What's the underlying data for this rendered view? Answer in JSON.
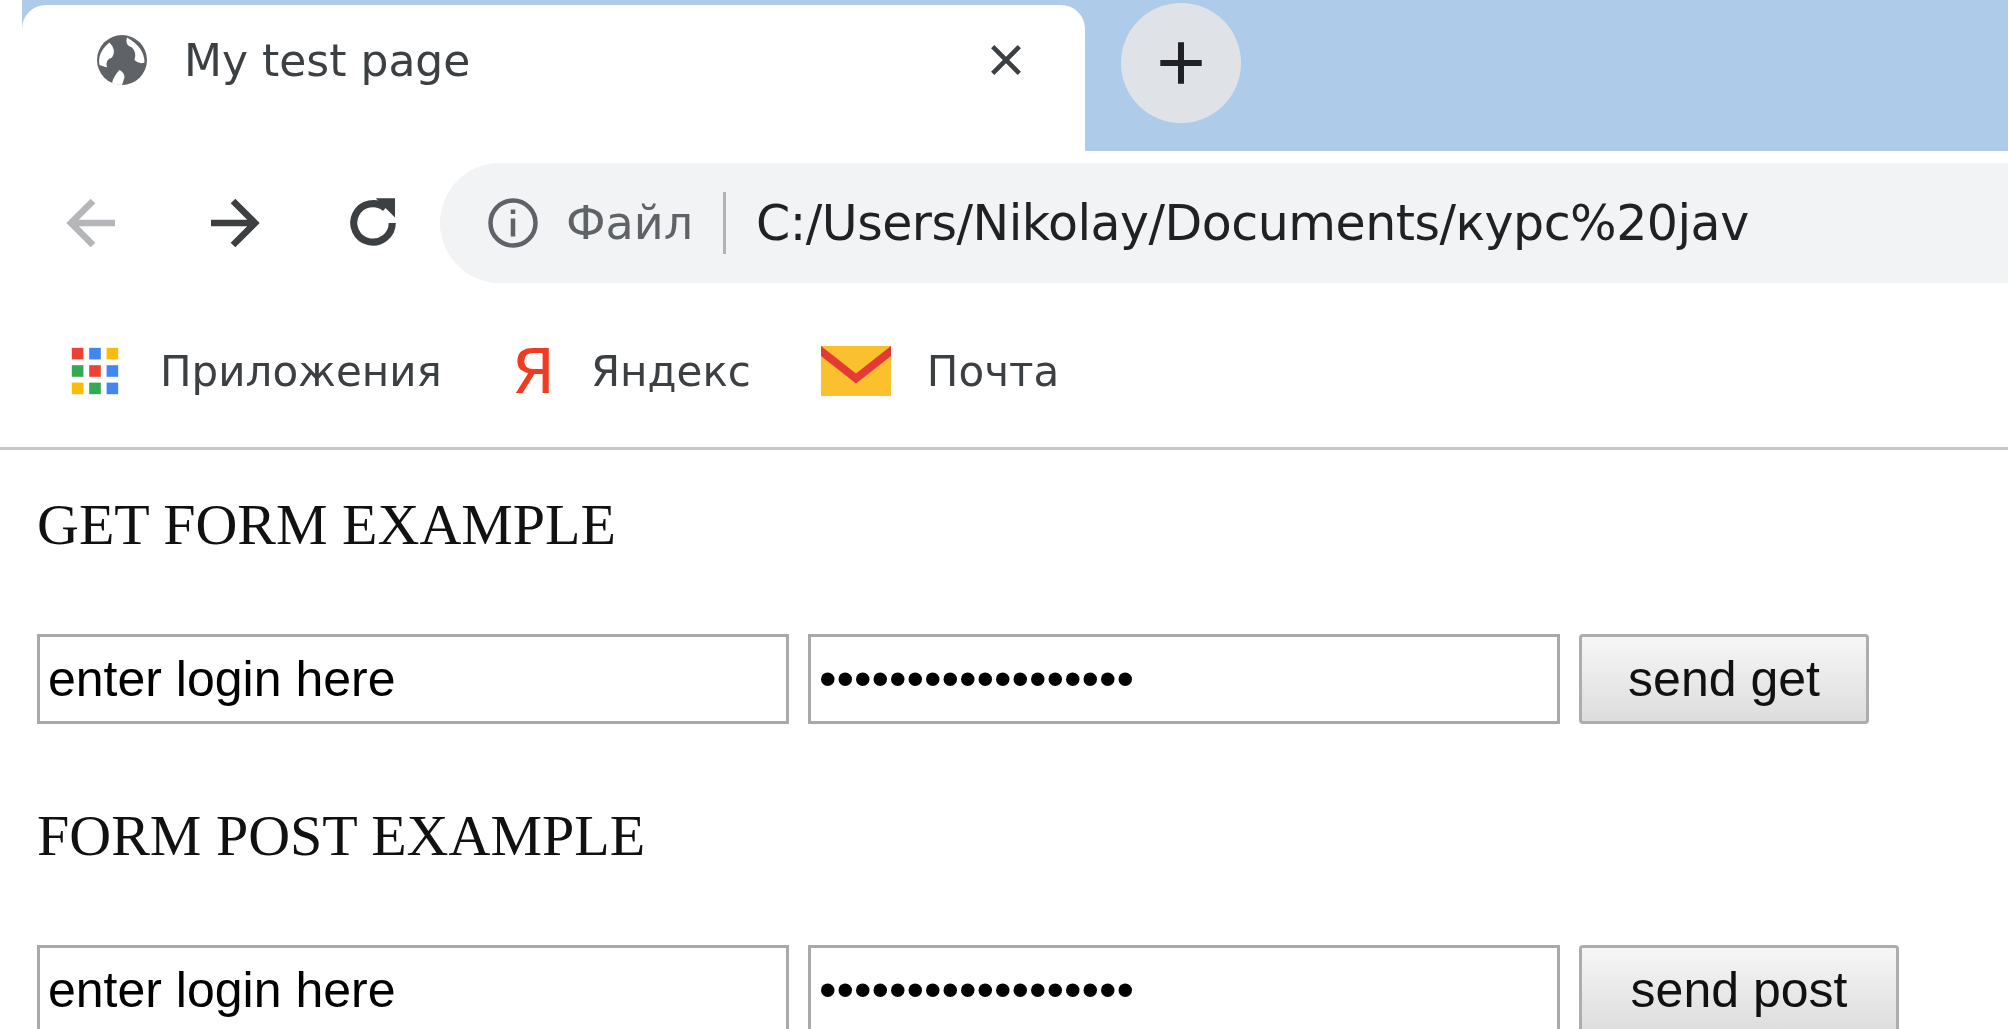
{
  "tabs": [
    {
      "title": "My test page",
      "selected": true
    }
  ],
  "navigation": {
    "back_enabled": false,
    "forward_enabled": true
  },
  "address_bar": {
    "scheme_label": "Файл",
    "url": "C:/Users/Nikolay/Documents/курс%20jav"
  },
  "bookmarks": [
    {
      "kind": "apps",
      "label": "Приложения"
    },
    {
      "kind": "yandex",
      "logo": "Я",
      "label": "Яндекс"
    },
    {
      "kind": "mail",
      "label": "Почта"
    }
  ],
  "forms": [
    {
      "heading": "GET FORM EXAMPLE",
      "login": "enter login here",
      "password": "••••••••••••••••••",
      "button": "send get"
    },
    {
      "heading": "FORM POST EXAMPLE",
      "login": "enter login here",
      "password": "••••••••••••••••••",
      "button": "send post"
    }
  ]
}
